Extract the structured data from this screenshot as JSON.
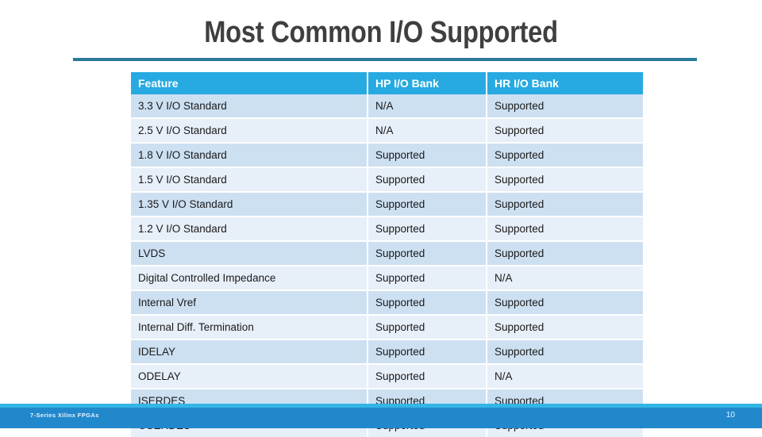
{
  "slide": {
    "title": "Most Common I/O Supported",
    "accent_color": "#27aae1",
    "rule_color": "#2a7b9b",
    "footer_bar_color": "#2288cc",
    "footer_accent_color": "#33b5e5",
    "row_color_a": "#cde0f2",
    "row_color_b": "#e7eff8"
  },
  "table": {
    "headers": [
      "Feature",
      "HP I/O Bank",
      "HR I/O Bank"
    ],
    "rows": [
      {
        "feature": "3.3 V I/O Standard",
        "hp": "N/A",
        "hr": "Supported"
      },
      {
        "feature": "2.5 V I/O Standard",
        "hp": "N/A",
        "hr": "Supported"
      },
      {
        "feature": "1.8 V I/O Standard",
        "hp": "Supported",
        "hr": "Supported"
      },
      {
        "feature": "1.5 V I/O Standard",
        "hp": "Supported",
        "hr": "Supported"
      },
      {
        "feature": "1.35 V I/O Standard",
        "hp": "Supported",
        "hr": "Supported"
      },
      {
        "feature": "1.2 V I/O Standard",
        "hp": "Supported",
        "hr": "Supported"
      },
      {
        "feature": "LVDS",
        "hp": "Supported",
        "hr": "Supported"
      },
      {
        "feature": "Digital Controlled Impedance",
        "hp": "Supported",
        "hr": "N/A"
      },
      {
        "feature": "Internal Vref",
        "hp": "Supported",
        "hr": "Supported"
      },
      {
        "feature": "Internal Diff. Termination",
        "hp": "Supported",
        "hr": "Supported"
      },
      {
        "feature": "IDELAY",
        "hp": "Supported",
        "hr": "Supported"
      },
      {
        "feature": "ODELAY",
        "hp": "Supported",
        "hr": "N/A"
      },
      {
        "feature": "ISERDES",
        "hp": "Supported",
        "hr": "Supported"
      },
      {
        "feature": "OSERDES",
        "hp": "Supported",
        "hr": "Supported"
      }
    ]
  },
  "footer": {
    "text": "7-Series Xilinx FPGAs",
    "page_number": "10"
  }
}
